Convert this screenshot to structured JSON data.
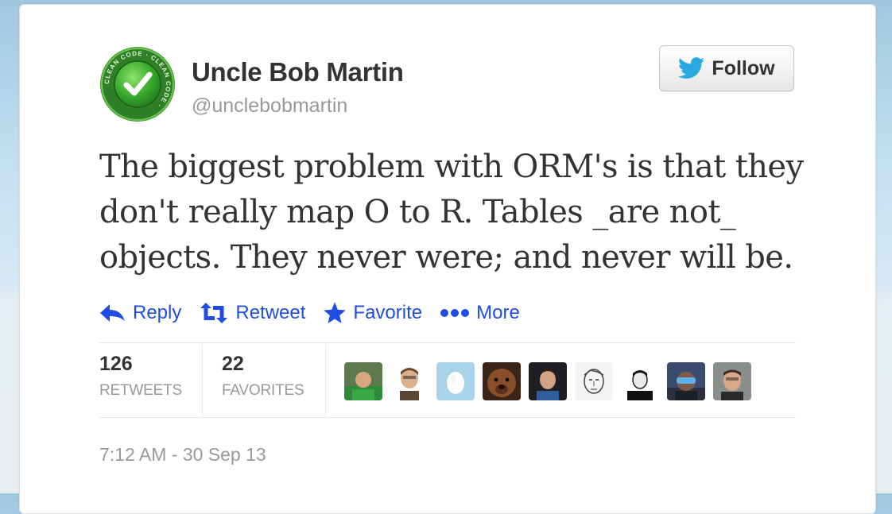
{
  "user": {
    "display_name": "Uncle Bob Martin",
    "handle": "@unclebobmartin",
    "avatar_icon": "clean-code-check-badge-icon",
    "avatar_ring_text": "CLEAN CODE · CLEAN CODE ·"
  },
  "follow_button": {
    "label": "Follow",
    "icon": "twitter-bird-icon"
  },
  "tweet": {
    "lines": [
      "The biggest problem with ORM's is that they",
      "don't really map O to R. Tables _are not_",
      "objects. They never were; and never will be."
    ]
  },
  "actions": [
    {
      "label": "Reply",
      "icon": "reply-arrow-icon"
    },
    {
      "label": "Retweet",
      "icon": "retweet-icon"
    },
    {
      "label": "Favorite",
      "icon": "star-icon"
    },
    {
      "label": "More",
      "icon": "more-dots-icon"
    }
  ],
  "stats": {
    "retweets": {
      "count": "126",
      "label": "RETWEETS"
    },
    "favorites": {
      "count": "22",
      "label": "FAVORITES"
    }
  },
  "favoriter_avatars": [
    "avatar-1",
    "avatar-2",
    "avatar-3",
    "avatar-4",
    "avatar-5",
    "avatar-6",
    "avatar-7",
    "avatar-8",
    "avatar-9"
  ],
  "timestamp": "7:12 AM - 30 Sep 13",
  "colors": {
    "link": "#1f4ce2",
    "text": "#333333",
    "muted": "#999999",
    "twitter_blue": "#2aa9e0",
    "badge_green": "#35a83a"
  }
}
